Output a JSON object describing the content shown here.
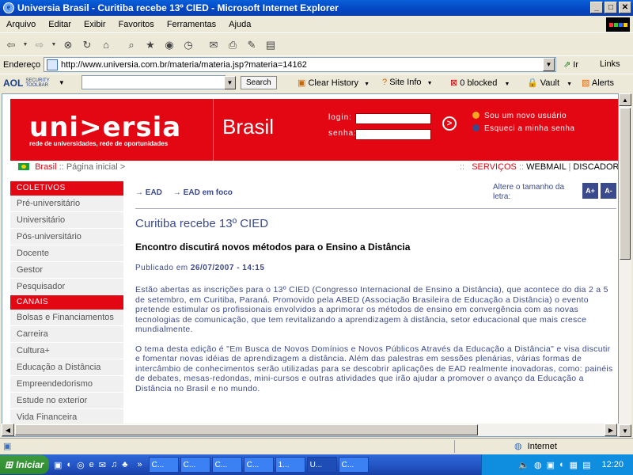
{
  "window": {
    "title": "Universia Brasil - Curitiba recebe 13º CIED - Microsoft Internet Explorer"
  },
  "menu": [
    "Arquivo",
    "Editar",
    "Exibir",
    "Favoritos",
    "Ferramentas",
    "Ajuda"
  ],
  "address": {
    "label": "Endereço",
    "url": "http://www.universia.com.br/materia/materia.jsp?materia=14162",
    "go": "Ir",
    "links": "Links"
  },
  "aol": {
    "brand": "AOL",
    "security": "SECURITY TOOLBAR",
    "search_btn": "Search",
    "clear_history": "Clear History",
    "site_info": "Site Info",
    "blocked": "0 blocked",
    "vault": "Vault",
    "alerts": "Alerts"
  },
  "header": {
    "logo": "uni>ersia",
    "logo_sub": "rede de universidades, rede de oportunidades",
    "country": "Brasil",
    "login_label": "login:",
    "password_label": "senha:",
    "go_symbol": ">",
    "new_user": "Sou um novo usuário",
    "forgot_password": "Esqueci a minha senha"
  },
  "breadcrumb": {
    "home": "Brasil",
    "sep": "::",
    "page": "Página inicial >"
  },
  "services": {
    "sep": "::",
    "label": "SERVIÇOS",
    "webmail": "WEBMAIL",
    "bar": "|",
    "discador": "DISCADOR",
    "more": "|  C"
  },
  "leftnav": {
    "coletivos_head": "COLETIVOS",
    "coletivos": [
      "Pré-universitário",
      "Universitário",
      "Pós-universitário",
      "Docente",
      "Gestor",
      "Pesquisador"
    ],
    "canais_head": "CANAIS",
    "canais": [
      "Bolsas e Financiamentos",
      "Carreira",
      "Cultura+",
      "Educação a Distância",
      "Empreendedorismo",
      "Estude no exterior",
      "Vida Financeira"
    ]
  },
  "article": {
    "nav": [
      "→  EAD",
      "→  EAD em foco"
    ],
    "font_label": "Altere o tamanho da letra:",
    "font_plus": "A+",
    "font_minus": "A-",
    "title": "Curitiba recebe 13º CIED",
    "subtitle": "Encontro discutirá novos métodos para o Ensino a Distância",
    "published_label": "Publicado em",
    "published_date": "26/07/2007 - 14:15",
    "p1": "Estão abertas as inscrições para o 13º CIED (Congresso Internacional de Ensino a Distância), que acontece do dia 2 a 5 de setembro, em Curitiba, Paraná. Promovido pela ABED (Associação Brasileira de Educação a Distância) o evento pretende estimular os profissionais envolvidos a aprimorar os métodos de ensino em convergência com as novas tecnologias de comunicação, que tem revitalizando a aprendizagem à distância, setor educacional que mais cresce mundialmente.",
    "p2": "O tema desta edição é \"Em Busca de Novos Domínios e Novos Públicos Através da Educação a Distância\" e visa discutir e fomentar novas idéias de aprendizagem a distância. Além das palestras em sessões plenárias, várias formas de intercâmbio de conhecimentos serão utilizadas para se descobrir aplicações de EAD realmente inovadoras, como: painéis de debates, mesas-redondas, mini-cursos e outras atividades que irão ajudar a promover o avanço da Educação a Distância no Brasil e no mundo."
  },
  "status": {
    "zone": "Internet"
  },
  "taskbar": {
    "start": "Iniciar",
    "tasks": [
      "C...",
      "C...",
      "C...",
      "C...",
      "1...",
      "U...",
      "C..."
    ],
    "clock": "12:20"
  },
  "colors": {
    "brand_red": "#e30613",
    "link_blue": "#3b4a8c"
  }
}
